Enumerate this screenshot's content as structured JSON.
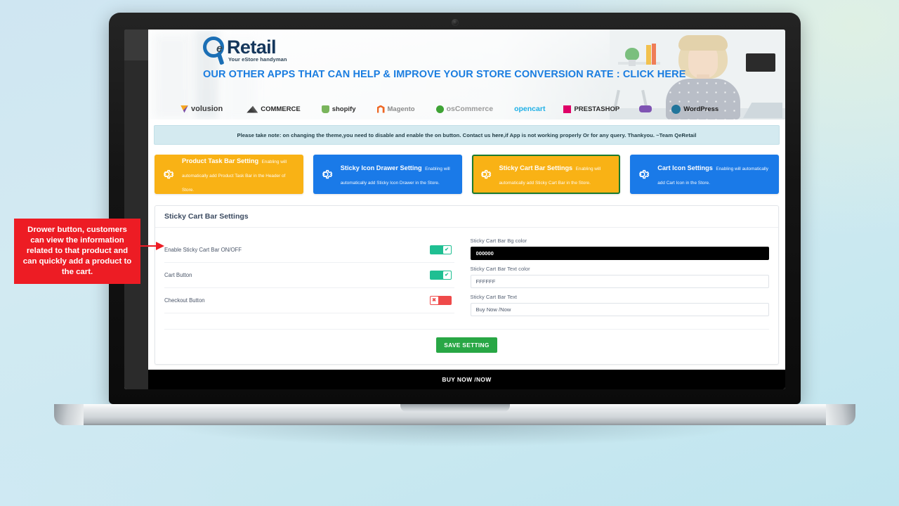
{
  "brand": {
    "logo_q": "Q",
    "logo_e": "e",
    "logo_word": "Retail",
    "logo_tagline": "Your eStore handyman"
  },
  "banner": {
    "headline": "OUR OTHER APPS THAT CAN HELP & IMPROVE YOUR STORE CONVERSION RATE : CLICK HERE",
    "platforms": [
      {
        "name": "volusion",
        "label": "volusion"
      },
      {
        "name": "bigcommerce",
        "label": "COMMERCE"
      },
      {
        "name": "shopify",
        "label": "shopify"
      },
      {
        "name": "magento",
        "label": "Magento"
      },
      {
        "name": "oscommerce",
        "label": "osCommerce"
      },
      {
        "name": "opencart",
        "label": "opencart"
      },
      {
        "name": "prestashop",
        "label": "PRESTASHOP"
      },
      {
        "name": "woocommerce",
        "label": "WOO"
      },
      {
        "name": "wordpress",
        "label": "WordPress"
      }
    ]
  },
  "notice": {
    "text_before": "Please take note: on changing the theme,you need to disable and enable the on button. Contact us ",
    "link": "here",
    "text_after": ",if App is not working properly Or for any query. Thankyou. ~Team QeRetail"
  },
  "cards": [
    {
      "title": "Product Task Bar Setting",
      "subtitle": "Enabling will automatically add Product Task Bar in the Header of Store.",
      "color": "#f9b215",
      "active": false
    },
    {
      "title": "Sticky Icon Drawer Setting",
      "subtitle": "Enabling will automatically add Sticky Icon Drawer in the Store.",
      "color": "#1a7ae8",
      "active": false
    },
    {
      "title": "Sticky Cart Bar Settings",
      "subtitle": "Enabling will automatically add Sticky Cart Bar in the Store.",
      "color": "#f9b215",
      "active": true
    },
    {
      "title": "Cart Icon Settings",
      "subtitle": "Enabling will automatically add Cart Icon in the Store.",
      "color": "#1a7ae8",
      "active": false
    }
  ],
  "panel": {
    "title": "Sticky Cart Bar Settings",
    "toggles": [
      {
        "label": "Enable Sticky Cart Bar ON/OFF",
        "state": "on",
        "glyph": "✔"
      },
      {
        "label": "Cart Button",
        "state": "on",
        "glyph": "✔"
      },
      {
        "label": "Checkout Button",
        "state": "off",
        "glyph": "✖"
      }
    ],
    "fields": [
      {
        "label": "Sticky Cart Bar Bg color",
        "value": "000000",
        "style": "dark"
      },
      {
        "label": "Sticky Cart Bar Text color",
        "value": "FFFFFF",
        "style": "light"
      },
      {
        "label": "Sticky Cart Bar Text",
        "value": "Buy Now /Now",
        "style": "light"
      }
    ],
    "save_label": "SAVE SETTING"
  },
  "sticky_bar": {
    "text": "BUY NOW /NOW"
  },
  "callout": {
    "text": "Drower button, customers can view the information related to that product and can quickly add a product to the cart."
  },
  "colors": {
    "accent_orange": "#f9b215",
    "accent_blue": "#1a7ae8",
    "active_border": "#1a7a2e",
    "toggle_on": "#1fbf92",
    "toggle_off": "#ef4a4a",
    "save_green": "#28a745",
    "callout_red": "#ed1c24",
    "headline_blue": "#1a7de0"
  }
}
